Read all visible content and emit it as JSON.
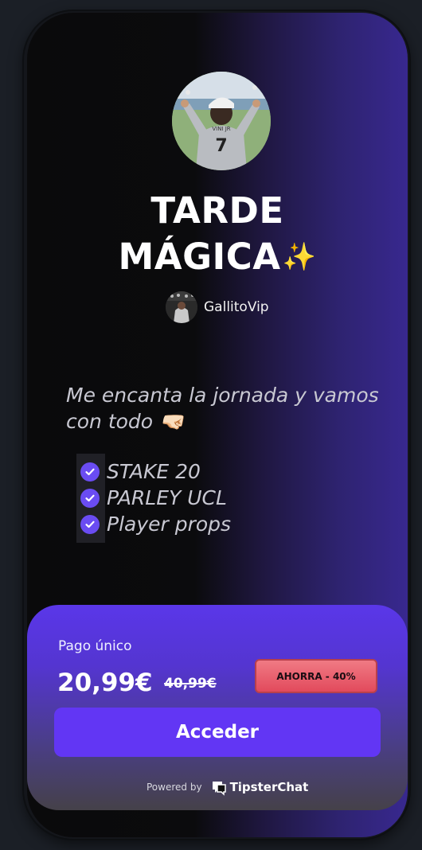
{
  "product": {
    "title_line1": "TARDE",
    "title_line2": "MÁGICA",
    "title_emoji": "✨",
    "creator_name": "GallitoVip",
    "avatar_jersey_name": "VINI JR",
    "avatar_jersey_number": "7"
  },
  "description": "Me encanta la jornada y vamos con todo 🤜🏻",
  "features": [
    "STAKE 20",
    "PARLEY UCL",
    "Player props"
  ],
  "purchase": {
    "pay_label": "Pago único",
    "price": "20,99€",
    "old_price": "40,99€",
    "badge": "AHORRA - 40%",
    "cta_label": "Acceder"
  },
  "footer": {
    "powered_by": "Powered by",
    "brand": "TipsterChat"
  },
  "colors": {
    "accent": "#6236f4",
    "card_gradient_top": "#5a37e9",
    "badge_red": "#e24a5c",
    "check_purple": "#6a4cf2"
  },
  "icons": [
    "check-icon",
    "tipsterchat-logo-icon"
  ]
}
